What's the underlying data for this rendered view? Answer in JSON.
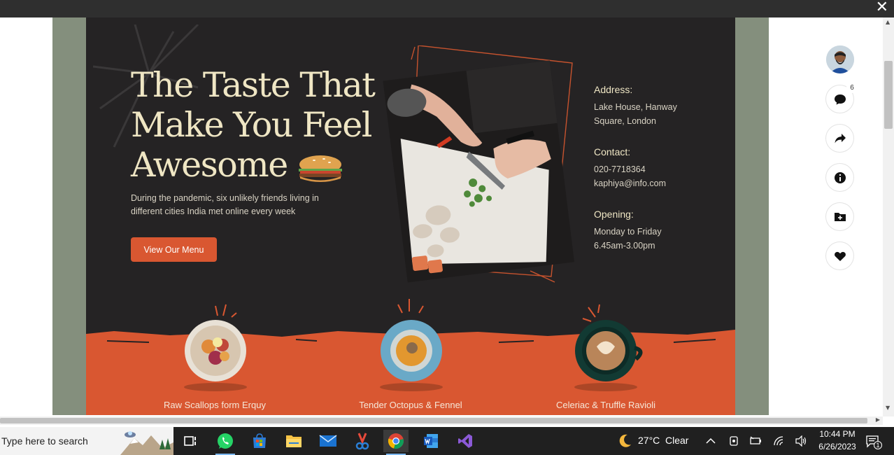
{
  "overlay": {
    "close_label": "✕"
  },
  "hero": {
    "headline_lines": [
      "The Taste That",
      "Make You Feel",
      "Awesome"
    ],
    "subtext": "During the pandemic, six unlikely friends living in different cities India met online every week",
    "cta_label": "View Our Menu"
  },
  "info": {
    "address_heading": "Address:",
    "address_line1": "Lake House, Hanway",
    "address_line2": "Square, London",
    "contact_heading": "Contact:",
    "phone": "020-7718364",
    "email": "kaphiya@info.com",
    "opening_heading": "Opening:",
    "days": "Monday to Friday",
    "hours": "6.45am-3.00pm"
  },
  "dishes": [
    {
      "name": "Raw Scallops form Erquy"
    },
    {
      "name": "Tender Octopus & Fennel"
    },
    {
      "name": "Celeriac & Truffle Ravioli"
    }
  ],
  "rail": {
    "comment_count": "6"
  },
  "taskbar": {
    "search_placeholder": "Type here to search",
    "weather_temp": "27°C",
    "weather_cond": "Clear",
    "time": "10:44 PM",
    "date": "6/26/2023",
    "notification_count": "1"
  },
  "colors": {
    "design_bg": "#252324",
    "accent_orange": "#d95731",
    "headline_cream": "#efe6c4",
    "frame_sage": "#848f7d"
  }
}
